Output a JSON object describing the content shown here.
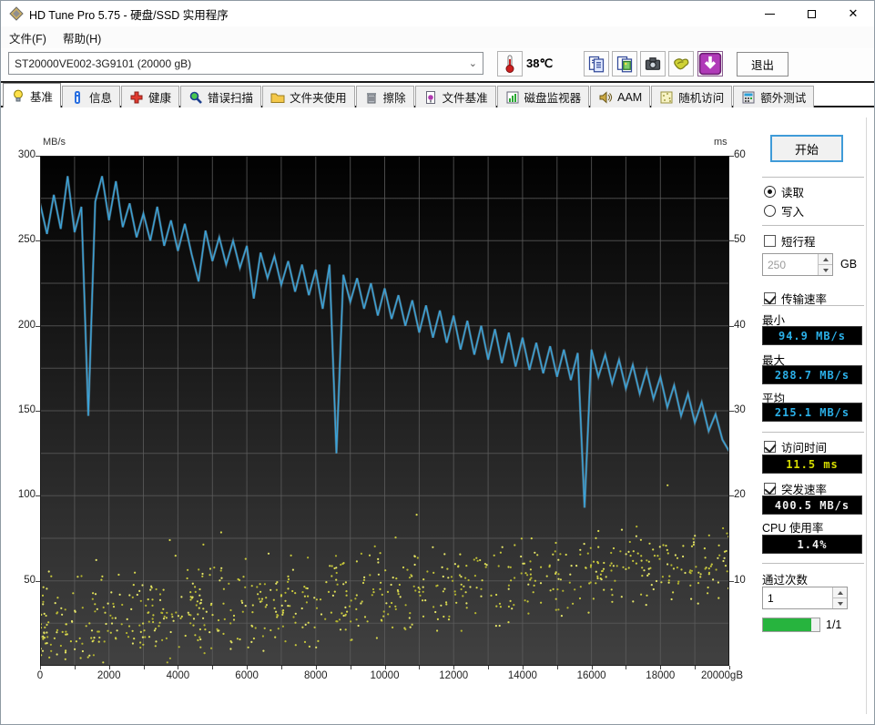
{
  "window": {
    "title": "HD Tune Pro 5.75 - 硬盘/SSD 实用程序"
  },
  "menu": {
    "file": "文件(F)",
    "help": "帮助(H)"
  },
  "toolbar": {
    "drive_selected": "ST20000VE002-3G9101  (20000 gB)",
    "temperature": "38℃",
    "exit_label": "退出",
    "icon_buttons": [
      "copy-text",
      "copy-image",
      "camera",
      "donate",
      "download"
    ]
  },
  "tabs": {
    "active_index": 0,
    "items": [
      {
        "label": "基准",
        "icon": "bulb"
      },
      {
        "label": "信息",
        "icon": "info"
      },
      {
        "label": "健康",
        "icon": "cross"
      },
      {
        "label": "错误扫描",
        "icon": "magnifier"
      },
      {
        "label": "文件夹使用",
        "icon": "folder"
      },
      {
        "label": "擦除",
        "icon": "trash"
      },
      {
        "label": "文件基准",
        "icon": "filebench"
      },
      {
        "label": "磁盘监视器",
        "icon": "diskmon"
      },
      {
        "label": "AAM",
        "icon": "speaker"
      },
      {
        "label": "随机访问",
        "icon": "randomaccess"
      },
      {
        "label": "额外测试",
        "icon": "extratests"
      }
    ]
  },
  "side_panel": {
    "start_label": "开始",
    "mode": {
      "read_label": "读取",
      "write_label": "写入",
      "selected": "read"
    },
    "short_stroke": {
      "label": "短行程",
      "checked": false,
      "value": "250",
      "unit": "GB"
    },
    "transfer_rate": {
      "label": "传输速率",
      "checked": true,
      "min_label": "最小",
      "min_value": "94.9 MB/s",
      "max_label": "最大",
      "max_value": "288.7 MB/s",
      "avg_label": "平均",
      "avg_value": "215.1 MB/s"
    },
    "access_time": {
      "label": "访问时间",
      "checked": true,
      "value": "11.5 ms"
    },
    "burst_rate": {
      "label": "突发速率",
      "checked": true,
      "value": "400.5 MB/s"
    },
    "cpu_usage": {
      "label": "CPU 使用率",
      "value": "1.4%"
    },
    "pass_count": {
      "label": "通过次数",
      "value": "1"
    },
    "progress": {
      "fraction": 0.85,
      "label": "1/1"
    }
  },
  "chart_data": {
    "type": "line+scatter",
    "x_axis": {
      "range": [
        0,
        20000
      ],
      "tick_values": [
        0,
        2000,
        4000,
        6000,
        8000,
        10000,
        12000,
        14000,
        16000,
        18000,
        20000
      ],
      "tick_labels": [
        "0",
        "2000",
        "4000",
        "6000",
        "8000",
        "10000",
        "12000",
        "14000",
        "16000",
        "18000",
        "20000gB"
      ]
    },
    "y_left": {
      "label": "MB/s",
      "range": [
        0,
        300
      ],
      "ticks": [
        300,
        250,
        200,
        150,
        100,
        50
      ]
    },
    "y_right": {
      "label": "ms",
      "range": [
        0,
        60
      ],
      "ticks": [
        60,
        50,
        40,
        30,
        20,
        10
      ]
    },
    "grid": {
      "x_step": 1000,
      "y_left_step": 25,
      "color": "#5c5c5c"
    },
    "plot_bg": {
      "top": "#010101",
      "bottom": "#414141"
    },
    "series": [
      {
        "name": "transfer-rate-line",
        "type": "line",
        "axis": "left",
        "color": "#3aa2d8",
        "points": [
          [
            0,
            272
          ],
          [
            200,
            254
          ],
          [
            400,
            277
          ],
          [
            600,
            257
          ],
          [
            800,
            288
          ],
          [
            1000,
            255
          ],
          [
            1200,
            270
          ],
          [
            1400,
            147
          ],
          [
            1600,
            273
          ],
          [
            1800,
            288
          ],
          [
            2000,
            262
          ],
          [
            2200,
            285
          ],
          [
            2400,
            258
          ],
          [
            2600,
            272
          ],
          [
            2800,
            252
          ],
          [
            3000,
            266
          ],
          [
            3200,
            250
          ],
          [
            3400,
            270
          ],
          [
            3600,
            247
          ],
          [
            3800,
            262
          ],
          [
            4000,
            244
          ],
          [
            4200,
            260
          ],
          [
            4400,
            242
          ],
          [
            4600,
            226
          ],
          [
            4800,
            256
          ],
          [
            5000,
            238
          ],
          [
            5200,
            252
          ],
          [
            5400,
            236
          ],
          [
            5600,
            250
          ],
          [
            5800,
            234
          ],
          [
            6000,
            247
          ],
          [
            6200,
            216
          ],
          [
            6400,
            243
          ],
          [
            6600,
            228
          ],
          [
            6800,
            241
          ],
          [
            7000,
            224
          ],
          [
            7200,
            238
          ],
          [
            7400,
            220
          ],
          [
            7600,
            236
          ],
          [
            7800,
            218
          ],
          [
            8000,
            233
          ],
          [
            8200,
            210
          ],
          [
            8400,
            236
          ],
          [
            8600,
            125
          ],
          [
            8800,
            230
          ],
          [
            9000,
            214
          ],
          [
            9200,
            228
          ],
          [
            9400,
            210
          ],
          [
            9600,
            225
          ],
          [
            9800,
            206
          ],
          [
            10000,
            222
          ],
          [
            10200,
            204
          ],
          [
            10400,
            218
          ],
          [
            10600,
            200
          ],
          [
            10800,
            215
          ],
          [
            11000,
            196
          ],
          [
            11200,
            212
          ],
          [
            11400,
            193
          ],
          [
            11600,
            209
          ],
          [
            11800,
            190
          ],
          [
            12000,
            206
          ],
          [
            12200,
            186
          ],
          [
            12400,
            203
          ],
          [
            12600,
            183
          ],
          [
            12800,
            200
          ],
          [
            13000,
            180
          ],
          [
            13200,
            198
          ],
          [
            13400,
            178
          ],
          [
            13600,
            196
          ],
          [
            13800,
            176
          ],
          [
            14000,
            193
          ],
          [
            14200,
            174
          ],
          [
            14400,
            190
          ],
          [
            14600,
            172
          ],
          [
            14800,
            188
          ],
          [
            15000,
            170
          ],
          [
            15200,
            186
          ],
          [
            15400,
            168
          ],
          [
            15600,
            184
          ],
          [
            15800,
            93
          ],
          [
            16000,
            186
          ],
          [
            16200,
            170
          ],
          [
            16400,
            183
          ],
          [
            16600,
            166
          ],
          [
            16800,
            180
          ],
          [
            17000,
            163
          ],
          [
            17200,
            177
          ],
          [
            17400,
            160
          ],
          [
            17600,
            174
          ],
          [
            17800,
            157
          ],
          [
            18000,
            170
          ],
          [
            18200,
            152
          ],
          [
            18400,
            165
          ],
          [
            18600,
            147
          ],
          [
            18800,
            160
          ],
          [
            19000,
            143
          ],
          [
            19200,
            155
          ],
          [
            19400,
            138
          ],
          [
            19600,
            148
          ],
          [
            19800,
            133
          ],
          [
            20000,
            126
          ]
        ]
      },
      {
        "name": "access-time-scatter",
        "type": "scatter",
        "axis": "right",
        "color": "#c8c83c",
        "generator": {
          "seed": 987654,
          "count": 760,
          "x_bias": 1.15,
          "ms_base_start": 4.2,
          "ms_base_end": 12.6,
          "spread_start": 6.8,
          "spread_end": 5.2,
          "outlier_rate": 0.02,
          "ms_min": 0.4,
          "ms_max": 24
        }
      }
    ]
  }
}
